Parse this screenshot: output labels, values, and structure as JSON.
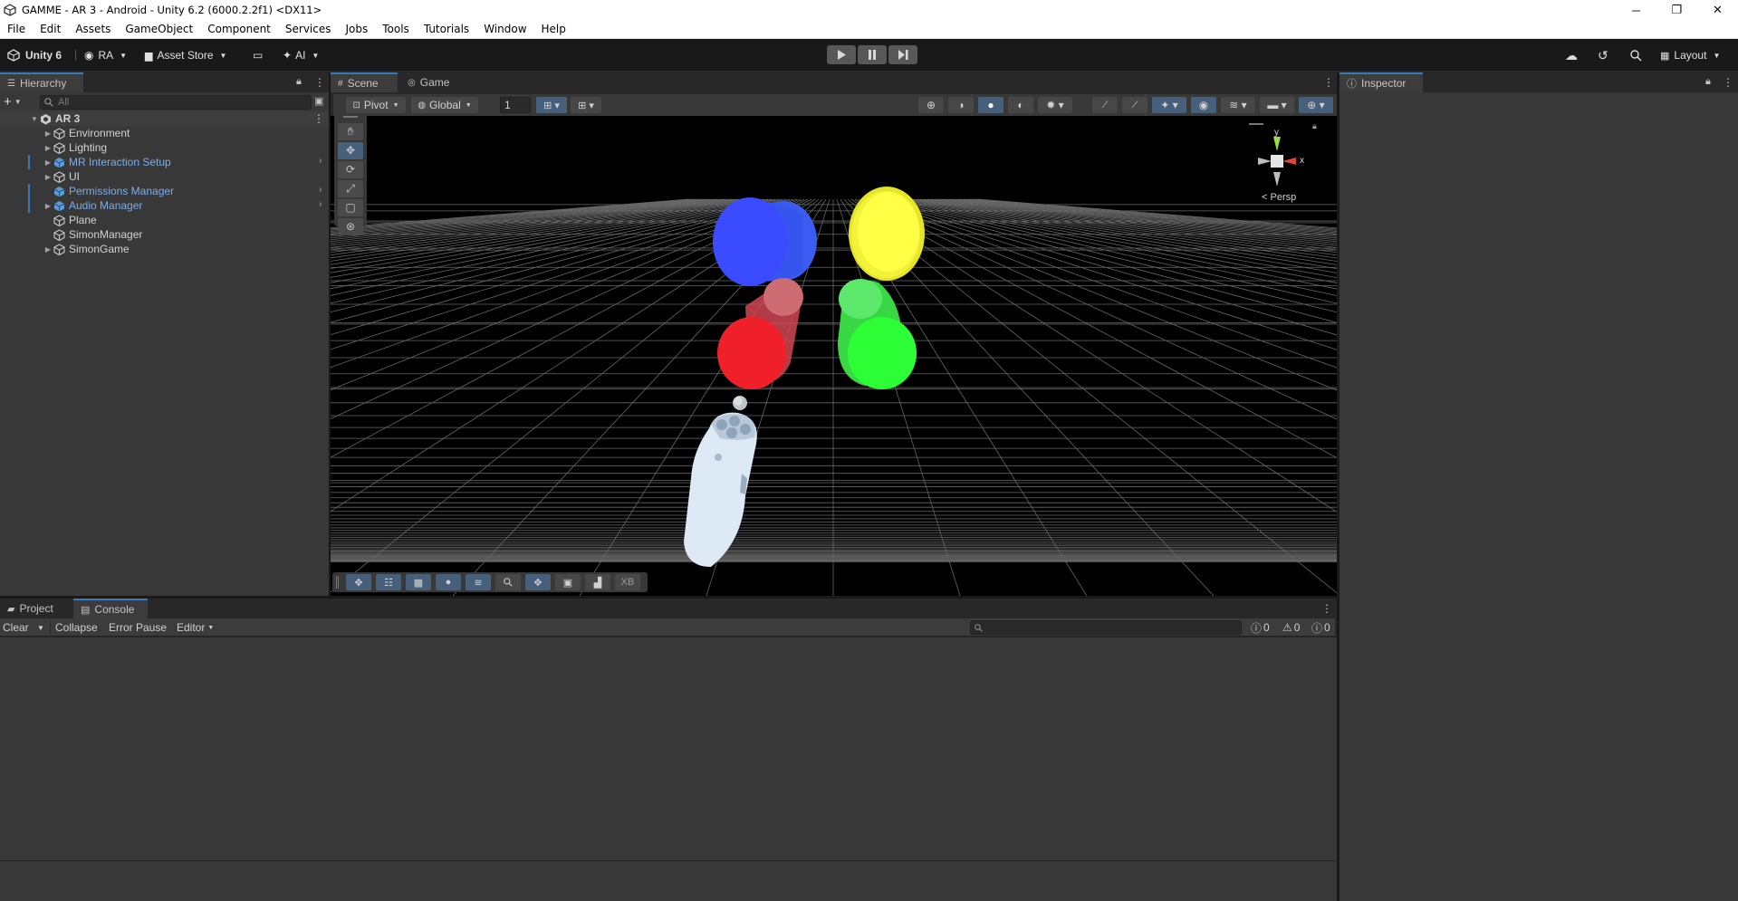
{
  "window": {
    "title": "GAMME - AR 3 - Android - Unity 6.2 (6000.2.2f1) <DX11>",
    "controls": [
      "─",
      "❐",
      "✕"
    ]
  },
  "menu": [
    "File",
    "Edit",
    "Assets",
    "GameObject",
    "Component",
    "Services",
    "Jobs",
    "Tools",
    "Tutorials",
    "Window",
    "Help"
  ],
  "toolbar": {
    "unity_label": "Unity 6",
    "account_label": "RA",
    "asset_store_label": "Asset Store",
    "ai_label": "AI",
    "layout_label": "Layout"
  },
  "hierarchy": {
    "tab_label": "Hierarchy",
    "search_placeholder": "All",
    "scene_name": "AR 3",
    "items": [
      {
        "label": "Environment"
      },
      {
        "label": "Lighting"
      },
      {
        "label": "MR Interaction Setup"
      },
      {
        "label": "UI"
      },
      {
        "label": "Permissions Manager"
      },
      {
        "label": "Audio Manager"
      },
      {
        "label": "Plane"
      },
      {
        "label": "SimonManager"
      },
      {
        "label": "SimonGame"
      }
    ]
  },
  "scene_view": {
    "tabs": [
      "Scene",
      "Game"
    ],
    "pivot_label": "Pivot",
    "global_label": "Global",
    "snap_value": "1",
    "gizmo": {
      "y": "y",
      "x": "x",
      "persp_label": "Persp"
    },
    "overlay_xb": "XB"
  },
  "inspector": {
    "tab_label": "Inspector"
  },
  "bottom": {
    "tabs": [
      "Project",
      "Console"
    ],
    "clear_label": "Clear",
    "collapse_label": "Collapse",
    "error_pause_label": "Error Pause",
    "editor_label": "Editor",
    "counts": [
      "0",
      "0",
      "0"
    ]
  }
}
